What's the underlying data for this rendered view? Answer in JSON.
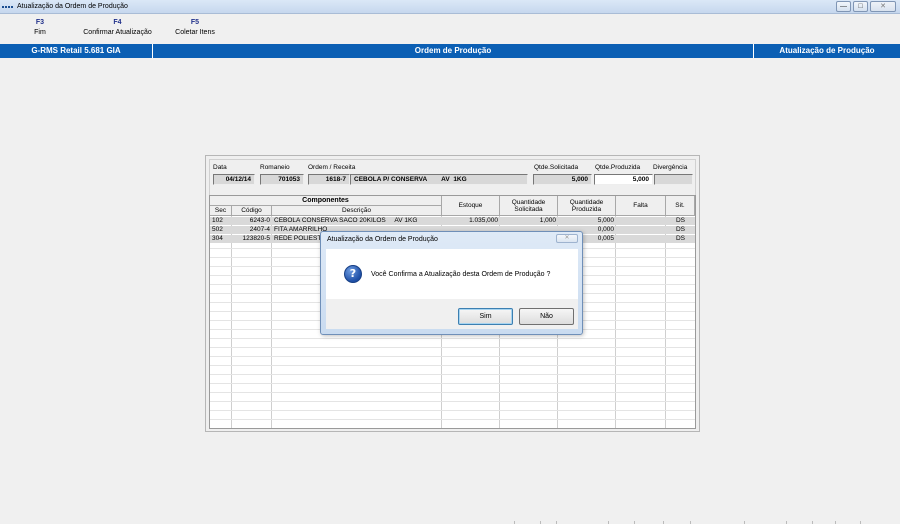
{
  "window": {
    "title": "Atualização da Ordem de Produção",
    "controls": [
      "minimize",
      "maximize",
      "close"
    ]
  },
  "function_keys": [
    {
      "key": "F3",
      "label": "Fim"
    },
    {
      "key": "F4",
      "label": "Confirmar Atualização"
    },
    {
      "key": "F5",
      "label": "Coletar Itens"
    }
  ],
  "header": {
    "app": "G-RMS Retail 5.681 GIA",
    "center": "Ordem de Produção",
    "right": "Atualização de Produção"
  },
  "form": {
    "data_label": "Data",
    "data_value": "04/12/14",
    "romaneio_label": "Romaneio",
    "romaneio_value": "701053",
    "ordem_label": "Ordem / Receita",
    "ordem_code": "1618-7",
    "ordem_desc": "CEBOLA P/ CONSERVA        AV  1KG",
    "qtde_solicitada_label": "Qtde.Solicitada",
    "qtde_solicitada_value": "5,000",
    "qtde_produzida_label": "Qtde.Produzida",
    "qtde_produzida_value": "5,000",
    "divergencia_label": "Divergência",
    "divergencia_value": ""
  },
  "grid": {
    "group_header": "Componentes",
    "headers": {
      "sec": "Sec",
      "codigo": "Código",
      "descricao": "Descrição",
      "estoque": "Estoque",
      "qtd_solicitada": "Quantidade Solicitada",
      "qtd_produzida": "Quantidade Produzida",
      "falta": "Falta",
      "sit": "Sit."
    },
    "rows": [
      {
        "sec": "102",
        "codigo": "6243-0",
        "descricao": "CEBOLA CONSERVA SACO 20KILOS     AV 1KG",
        "estoque": "1.035,000",
        "qtd_solicitada": "1,000",
        "qtd_produzida": "5,000",
        "falta": "",
        "sit": "DS"
      },
      {
        "sec": "502",
        "codigo": "2407-4",
        "descricao": "FITA AMARRILHO",
        "estoque": "",
        "qtd_solicitada": "",
        "qtd_produzida": "0,000",
        "falta": "",
        "sit": "DS"
      },
      {
        "sec": "304",
        "codigo": "123820-5",
        "descricao": "REDE POLIESTE",
        "estoque": "",
        "qtd_solicitada": "",
        "qtd_produzida": "0,005",
        "falta": "",
        "sit": "DS"
      }
    ]
  },
  "dialog": {
    "title": "Atualização da Ordem de Produção",
    "message": "Você Confirma a Atualização desta Ordem de Produção ?",
    "icon": "question-icon",
    "icon_glyph": "?",
    "buttons": {
      "yes": "Sim",
      "no": "Não"
    }
  },
  "colors": {
    "header_bar": "#0b5fb4",
    "function_key": "#1f2f8a",
    "row_fill": "#d9d9d9"
  }
}
